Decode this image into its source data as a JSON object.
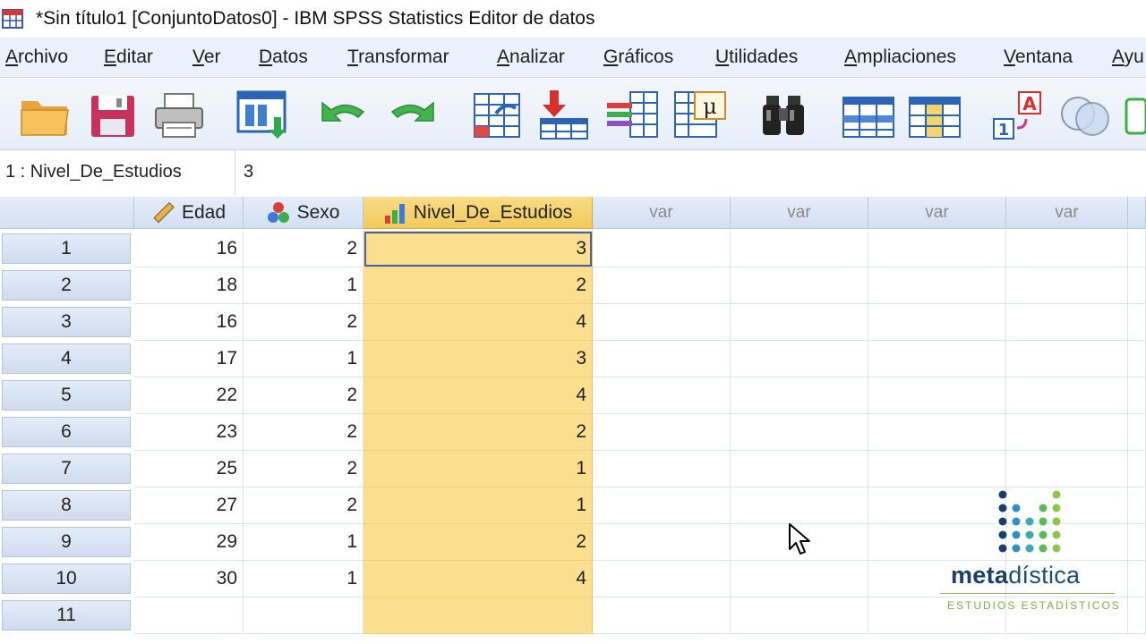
{
  "window": {
    "title": "*Sin título1 [ConjuntoDatos0] - IBM SPSS Statistics Editor de datos"
  },
  "menu": [
    "Archivo",
    "Editar",
    "Ver",
    "Datos",
    "Transformar",
    "Analizar",
    "Gráficos",
    "Utilidades",
    "Ampliaciones",
    "Ventana",
    "Ayu"
  ],
  "toolbar": [
    "open-folder-icon",
    "save-icon",
    "print-icon",
    "recall-dialog-icon",
    "undo-icon",
    "redo-icon",
    "go-to-case-icon",
    "go-to-variable-icon",
    "variables-icon",
    "descriptives-icon",
    "find-icon",
    "insert-cases-icon",
    "insert-variable-icon",
    "value-labels-icon",
    "use-sets-icon"
  ],
  "cell_editor": {
    "reference": "1 : Nivel_De_Estudios",
    "value": "3"
  },
  "columns": [
    {
      "name": "Edad",
      "icon": "scale-ruler-icon"
    },
    {
      "name": "Sexo",
      "icon": "nominal-icon"
    },
    {
      "name": "Nivel_De_Estudios",
      "icon": "ordinal-bars-icon"
    },
    {
      "name": "var"
    },
    {
      "name": "var"
    },
    {
      "name": "var"
    },
    {
      "name": "var"
    }
  ],
  "rows": [
    {
      "n": "1",
      "vals": [
        "16",
        "2",
        "3"
      ]
    },
    {
      "n": "2",
      "vals": [
        "18",
        "1",
        "2"
      ]
    },
    {
      "n": "3",
      "vals": [
        "16",
        "2",
        "4"
      ]
    },
    {
      "n": "4",
      "vals": [
        "17",
        "1",
        "3"
      ]
    },
    {
      "n": "5",
      "vals": [
        "22",
        "2",
        "4"
      ]
    },
    {
      "n": "6",
      "vals": [
        "23",
        "2",
        "2"
      ]
    },
    {
      "n": "7",
      "vals": [
        "25",
        "2",
        "1"
      ]
    },
    {
      "n": "8",
      "vals": [
        "27",
        "2",
        "1"
      ]
    },
    {
      "n": "9",
      "vals": [
        "29",
        "1",
        "2"
      ]
    },
    {
      "n": "10",
      "vals": [
        "30",
        "1",
        "4"
      ]
    },
    {
      "n": "11",
      "vals": [
        "",
        "",
        ""
      ]
    }
  ],
  "logo": {
    "brand_bold": "meta",
    "brand_rest": "dística",
    "tagline": "ESTUDIOS ESTADÍSTICOS"
  },
  "colors": {
    "selected_column": "#fbde8e",
    "header": "#d9e5f5",
    "menubar": "#eaf1fb"
  }
}
